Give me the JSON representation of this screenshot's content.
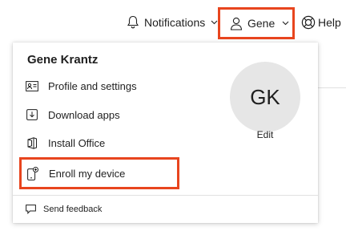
{
  "header": {
    "notifications_label": "Notifications",
    "account_label": "Gene",
    "help_label": "Help"
  },
  "account_menu": {
    "user_name": "Gene Krantz",
    "avatar_initials": "GK",
    "edit_label": "Edit",
    "items": [
      {
        "label": "Profile and settings",
        "icon": "profile-card-icon"
      },
      {
        "label": "Download apps",
        "icon": "download-icon"
      },
      {
        "label": "Install Office",
        "icon": "office-icon"
      },
      {
        "label": "Enroll my device",
        "icon": "phone-add-icon"
      }
    ],
    "feedback_label": "Send feedback"
  },
  "colors": {
    "highlight": "#e8451e",
    "avatar_bg": "#e6e6e6"
  }
}
